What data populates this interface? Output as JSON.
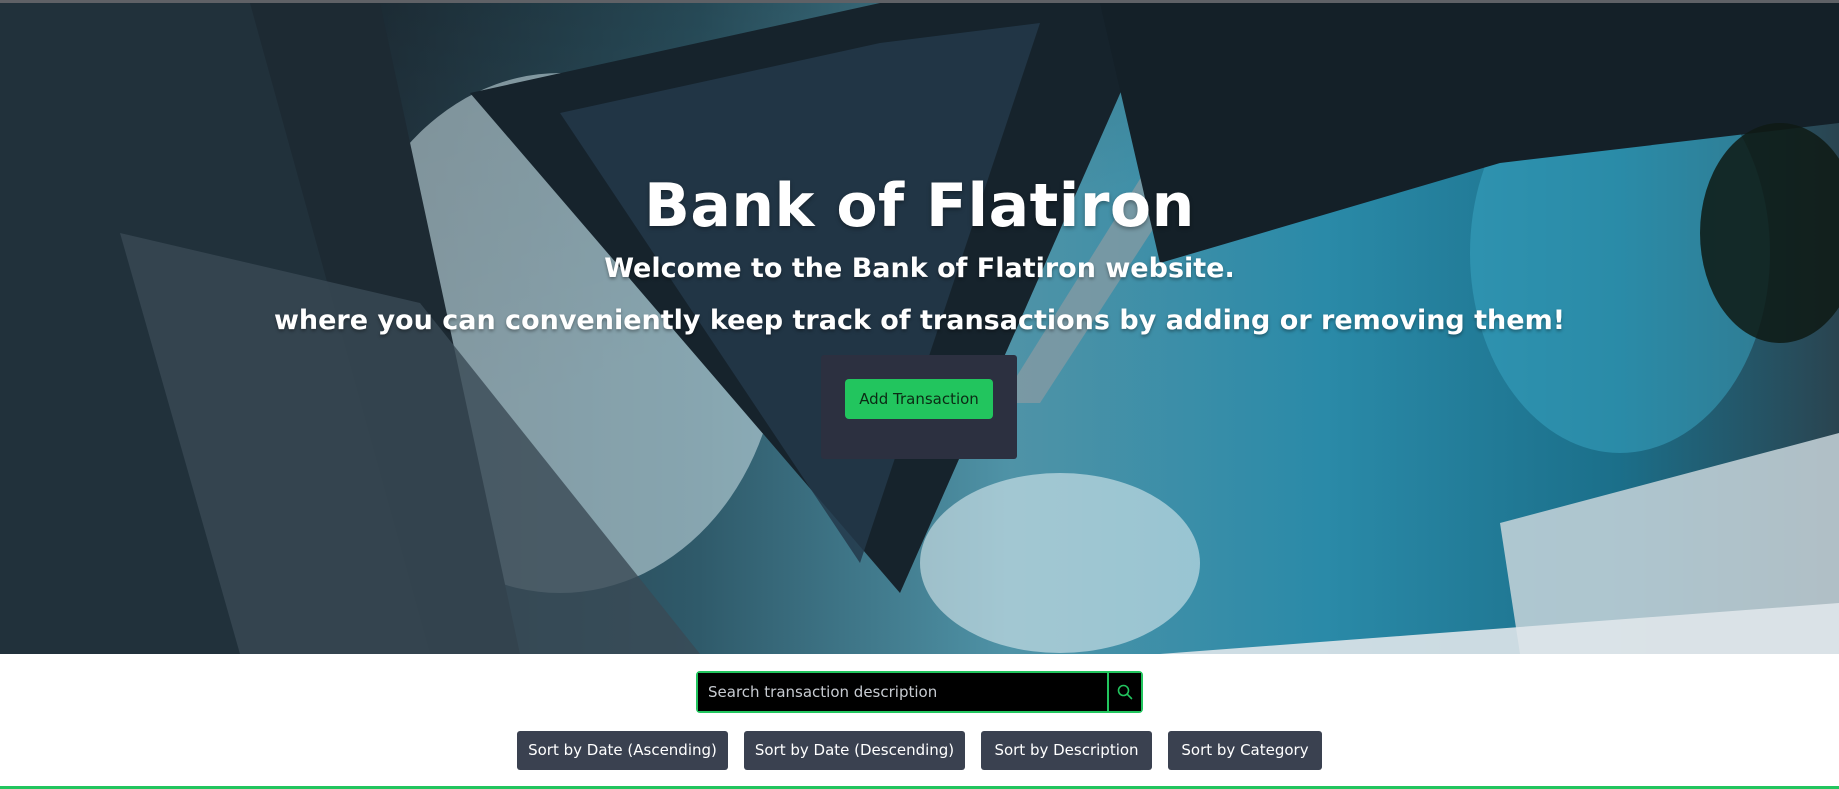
{
  "hero": {
    "title": "Bank of Flatiron",
    "subtitle": "Welcome to the Bank of Flatiron website.",
    "tagline": "where you can conveniently keep track of transactions by adding or removing them!",
    "add_button_label": "Add Transaction"
  },
  "search": {
    "placeholder": "Search transaction description",
    "value": "",
    "icon": "search-icon"
  },
  "sort_buttons": [
    {
      "label": "Sort by Date (Ascending)"
    },
    {
      "label": "Sort by Date (Descending)"
    },
    {
      "label": "Sort by Description"
    },
    {
      "label": "Sort by Category"
    }
  ],
  "colors": {
    "accent": "#22c55e",
    "panel": "#2c3040",
    "button": "#3a4150"
  }
}
